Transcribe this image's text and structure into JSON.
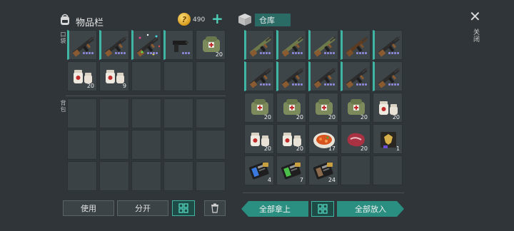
{
  "inventory": {
    "title": "物品栏",
    "gold": "490",
    "coin_glyph": "?",
    "add_label": "+",
    "pocket_label": "口袋",
    "backpack_label": "背包",
    "pocket_slots": [
      {
        "item": "assault-rifle",
        "count": null,
        "dots": 4
      },
      {
        "item": "assault-rifle",
        "count": null,
        "dots": 4
      },
      {
        "item": "festive-rifle",
        "count": null,
        "dots": 4
      },
      {
        "item": "pistol",
        "count": null,
        "dots": 3
      },
      {
        "item": "first-aid-kit-bag",
        "count": "20",
        "dots": 0
      },
      {
        "item": "medicine-bottles",
        "count": "20",
        "dots": 0
      },
      {
        "item": "medicine-bottles",
        "count": "9",
        "dots": 0
      }
    ],
    "buttons": {
      "use": "使用",
      "split": "分开"
    }
  },
  "storage": {
    "title": "仓库",
    "slots": [
      {
        "item": "camo-rifle",
        "count": null,
        "dots": 4
      },
      {
        "item": "camo-rifle",
        "count": null,
        "dots": 4
      },
      {
        "item": "camo-rifle",
        "count": null,
        "dots": 4
      },
      {
        "item": "shotgun",
        "count": null,
        "dots": 4
      },
      {
        "item": "assault-rifle",
        "count": null,
        "dots": 4
      },
      {
        "item": "assault-rifle",
        "count": null,
        "dots": 4
      },
      {
        "item": "assault-rifle",
        "count": null,
        "dots": 4
      },
      {
        "item": "assault-rifle",
        "count": null,
        "dots": 4
      },
      {
        "item": "assault-rifle",
        "count": null,
        "dots": 4
      },
      {
        "item": "assault-rifle",
        "count": null,
        "dots": 4
      },
      {
        "item": "first-aid-kit-bag",
        "count": "20",
        "dots": 0
      },
      {
        "item": "first-aid-kit-bag",
        "count": "20",
        "dots": 0
      },
      {
        "item": "first-aid-kit-bag",
        "count": "20",
        "dots": 0
      },
      {
        "item": "first-aid-kit-bag",
        "count": "20",
        "dots": 0
      },
      {
        "item": "medicine-bottles",
        "count": "20",
        "dots": 0
      },
      {
        "item": "medicine-bottles",
        "count": "20",
        "dots": 0
      },
      {
        "item": "medicine-bottles",
        "count": "20",
        "dots": 0
      },
      {
        "item": "food-plate",
        "count": "17",
        "dots": 0
      },
      {
        "item": "raw-meat",
        "count": "20",
        "dots": 0
      },
      {
        "item": "badge-wallet",
        "count": "1",
        "dots": 0
      },
      {
        "item": "blue-card",
        "count": "4",
        "dots": 0
      },
      {
        "item": "green-card",
        "count": "7",
        "dots": 0
      },
      {
        "item": "brown-card",
        "count": "24",
        "dots": 0
      }
    ],
    "buttons": {
      "take_all": "全部拿上",
      "put_all": "全部放入"
    }
  },
  "close_label": "关闭",
  "colors": {
    "accent": "#3fb5a3",
    "background": "#2f3538",
    "slot": "#3a4246",
    "rarity_dots": "#8f88d8"
  }
}
